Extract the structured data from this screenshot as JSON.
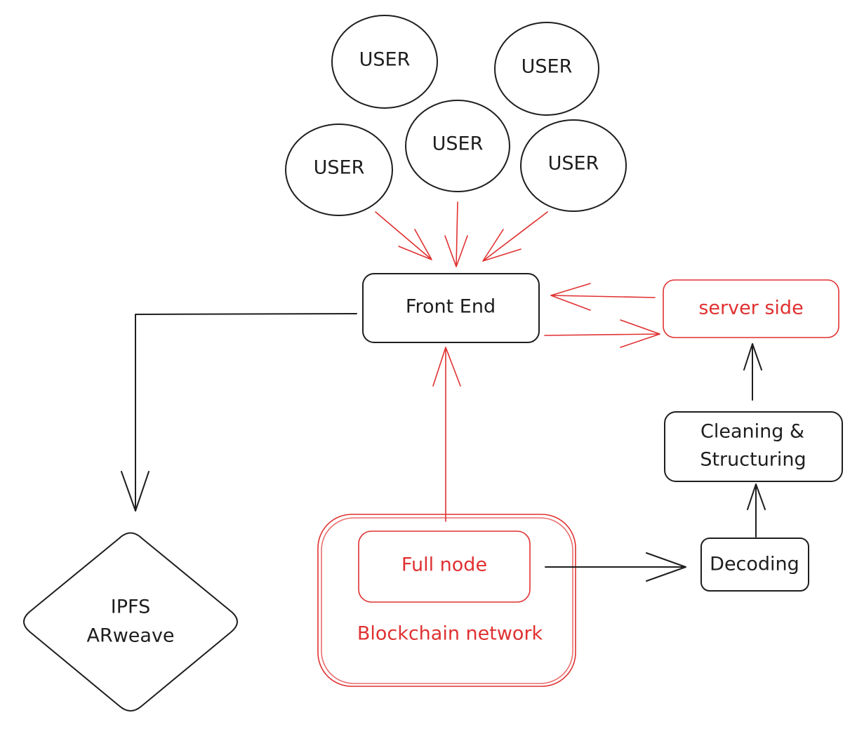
{
  "colors": {
    "stroke": "#1e1e1e",
    "accent": "#e03131",
    "background": "#ffffff"
  },
  "nodes": {
    "users": [
      "USER",
      "USER",
      "USER",
      "USER",
      "USER"
    ],
    "front_end": "Front End",
    "server_side": "server side",
    "cleaning": [
      "Cleaning &",
      "Structuring"
    ],
    "decoding": "Decoding",
    "full_node": "Full node",
    "blockchain": "Blockchain network",
    "storage": [
      "IPFS",
      "ARweave"
    ]
  }
}
